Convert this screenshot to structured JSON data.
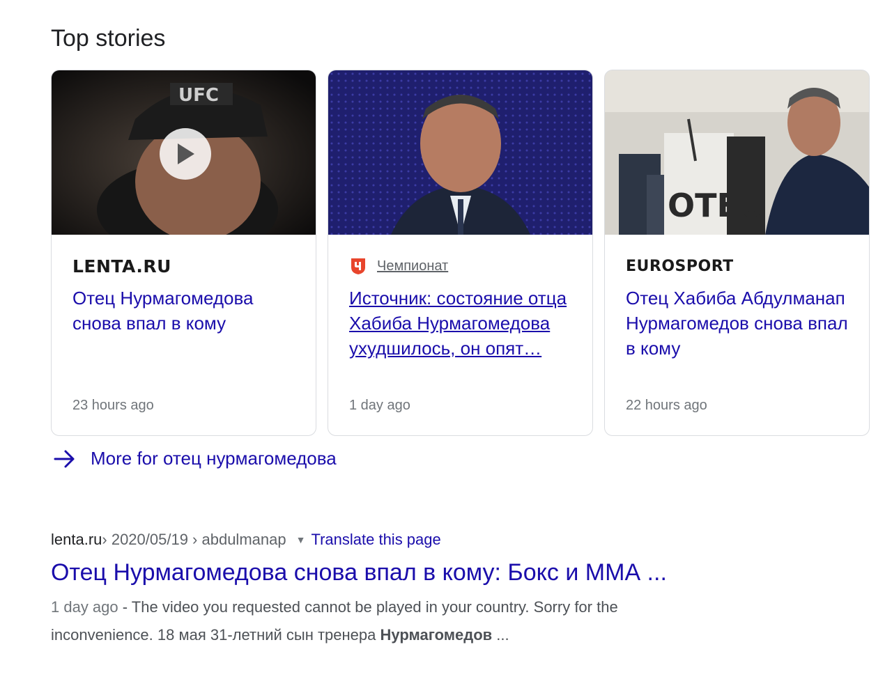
{
  "top_stories": {
    "title": "Top stories",
    "cards": [
      {
        "source_logo": "LENTA.RU",
        "headline": "Отец Нурмагомедова снова впал в кому",
        "time": "23 hours ago",
        "has_video": true
      },
      {
        "source_icon": "championat-icon",
        "source_name": "Чемпионат",
        "headline": "Источник: состояние отца Хабиба Нурмагомедова ухудшилось, он опят…",
        "time": "1 day ago"
      },
      {
        "source_logo": "EUROSPORT",
        "headline": "Отец Хабиба Абдулманап Нурмагомедов снова впал в кому",
        "time": "22 hours ago"
      }
    ],
    "more_link": "More for отец нурмагомедова"
  },
  "result": {
    "domain": "lenta.ru",
    "path": " › 2020/05/19 › abdulmanap",
    "translate": "Translate this page",
    "title": "Отец Нурмагомедова снова впал в кому: Бокс и ММА ...",
    "snippet_date": "1 day ago",
    "snippet_sep": " - ",
    "snippet_text": "The video you requested cannot be played in your country. Sorry for the inconvenience. 18 мая 31-летний сын тренера ",
    "snippet_bold": "Нурмагомедов",
    "snippet_end": " ..."
  },
  "colors": {
    "link": "#1a0dab",
    "meta": "#70757a",
    "border": "#dadce0",
    "championat_red": "#e8452c"
  }
}
